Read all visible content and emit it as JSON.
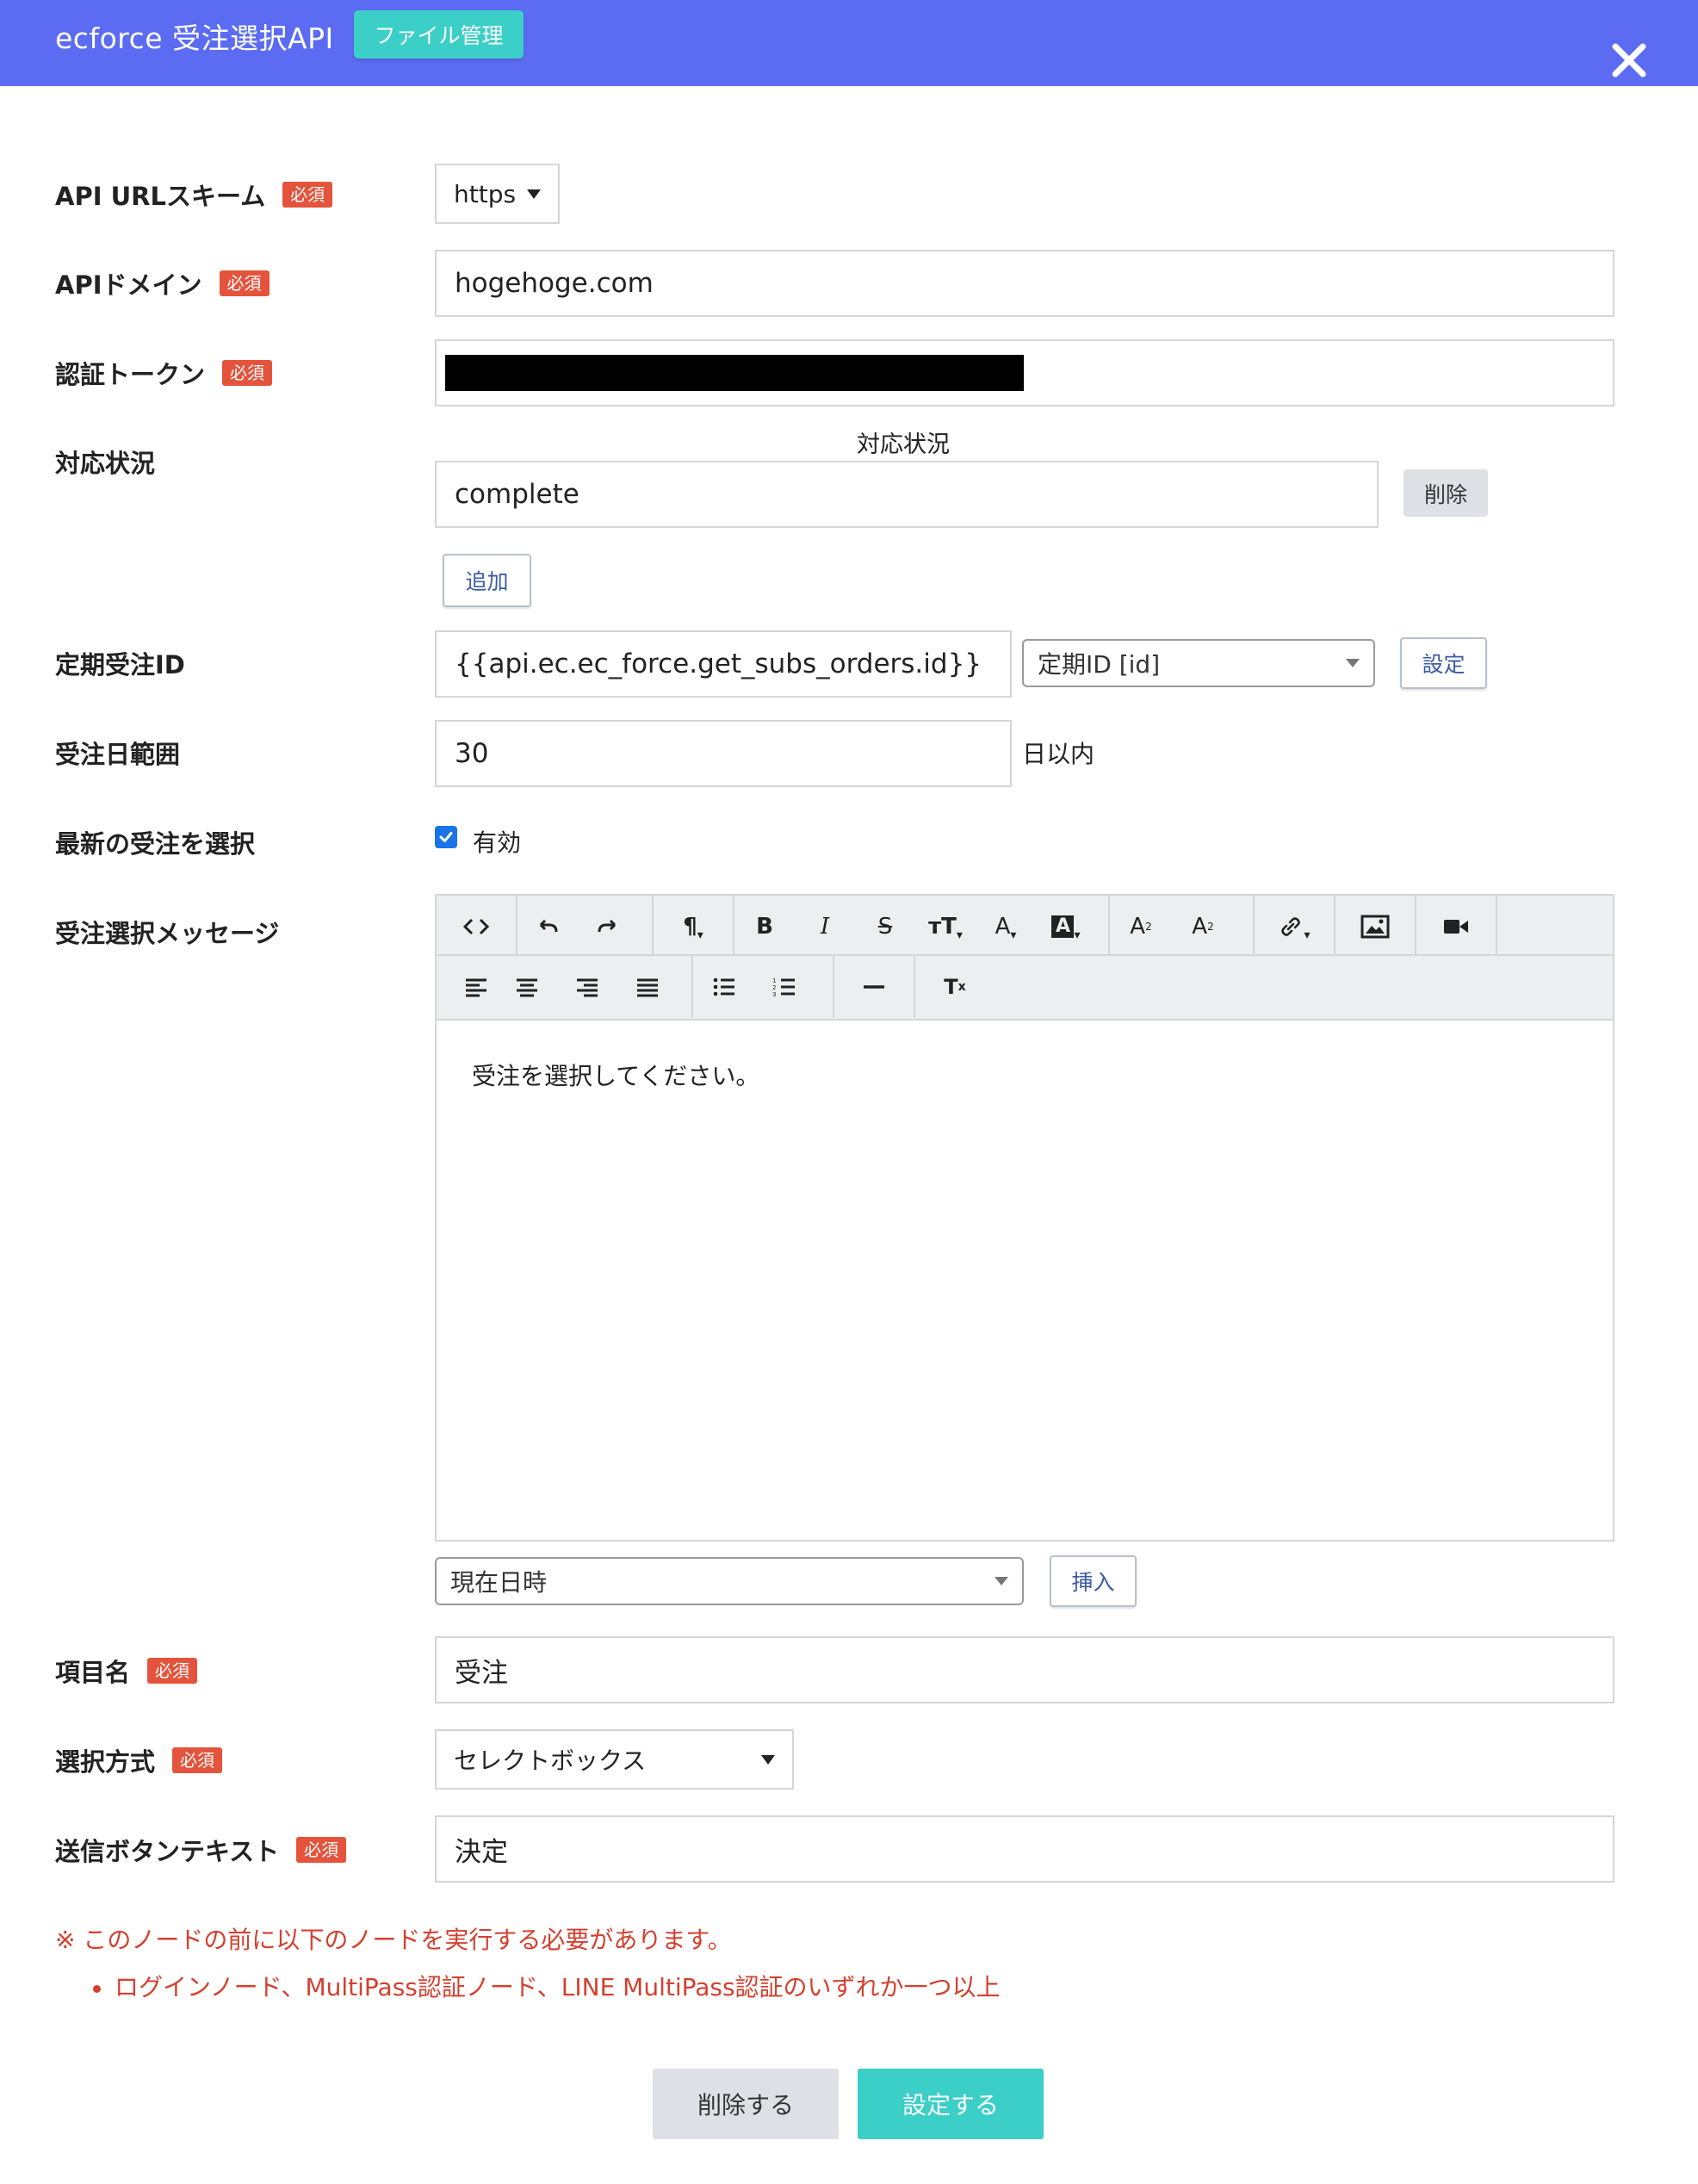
{
  "header": {
    "title": "ecforce 受注選択API",
    "file_button": "ファイル管理",
    "close_icon": "close-icon"
  },
  "required_badge": "必須",
  "form": {
    "scheme": {
      "label": "API URLスキーム",
      "value": "https"
    },
    "domain": {
      "label": "APIドメイン",
      "value": "hogehoge.com"
    },
    "token": {
      "label": "認証トークン"
    },
    "status": {
      "label": "対応状況",
      "column_header": "対応状況",
      "value": "complete",
      "delete_button": "削除",
      "add_button": "追加"
    },
    "subs_order_id": {
      "label": "定期受注ID",
      "value": "{{api.ec.ec_force.get_subs_orders.id}}",
      "select_value": "定期ID [id]",
      "set_button": "設定"
    },
    "date_range": {
      "label": "受注日範囲",
      "value": "30",
      "suffix": "日以内"
    },
    "latest": {
      "label": "最新の受注を選択",
      "checkbox_label": "有効",
      "checked": true
    },
    "message": {
      "label": "受注選択メッセージ",
      "content": "受注を選択してください。",
      "variable_select": "現在日時",
      "insert_button": "挿入"
    },
    "item_name": {
      "label": "項目名",
      "value": "受注"
    },
    "select_method": {
      "label": "選択方式",
      "value": "セレクトボックス"
    },
    "submit_text": {
      "label": "送信ボタンテキスト",
      "value": "決定"
    }
  },
  "notes": {
    "main": "※ このノードの前に以下のノードを実行する必要があります。",
    "items": [
      "ログインノード、MultiPass認証ノード、LINE MultiPass認証のいずれか一つ以上"
    ]
  },
  "footer": {
    "delete_button": "削除する",
    "save_button": "設定する"
  },
  "colors": {
    "header": "#5b6cf2",
    "accent": "#3ccfc8",
    "badge": "#e4543c",
    "note": "#d4402f"
  }
}
